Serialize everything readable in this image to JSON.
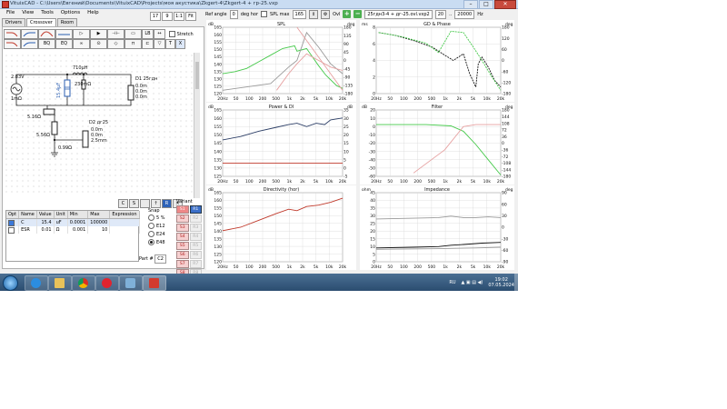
{
  "window": {
    "title": "VituixCAD - C:\\Users\\Евгений\\Documents\\VituixCAD\\Projects\\моя акустика\\Zkgert-4\\Zkgert-4 + гр-25.vxp",
    "min": "–",
    "max": "□",
    "close": "✕"
  },
  "menu": [
    "File",
    "View",
    "Tools",
    "Options",
    "Help"
  ],
  "topstrip": [
    "17",
    "9",
    "1:1",
    "Fit"
  ],
  "toolbar": {
    "ref_angle_label": "Ref angle",
    "ref_angle": "0",
    "ref_angle_unit": "deg hor",
    "spl_max_label": "SPL max",
    "spl_max": "165",
    "ovl_label": "Ovl",
    "ovl_file": "25гдн3-4 + дг-25.ovl.vxp2",
    "f_from": "20",
    "f_to": "20000",
    "f_unit": "Hz"
  },
  "tabs": [
    "Drivers",
    "Crossover",
    "Room"
  ],
  "palette": [
    {
      "label": "LP"
    },
    {
      "label": "HP"
    },
    {
      "label": "BP"
    },
    {
      "label": "AP"
    },
    {
      "label": "▷"
    },
    {
      "label": "▶"
    },
    {
      "label": "⊣⊢"
    },
    {
      "label": "▭"
    },
    {
      "label": "LP2"
    },
    {
      "label": "HP2"
    },
    {
      "label": "BQ"
    },
    {
      "label": "EQ"
    },
    {
      "label": "∞"
    },
    {
      "label": "⊙"
    },
    {
      "label": "◇"
    },
    {
      "label": "⊓"
    }
  ],
  "palette_right": [
    "LB",
    "↔",
    "⊏",
    "▽",
    "T",
    "X"
  ],
  "stretch_label": "Stretch",
  "schematic": {
    "source": "2.83V",
    "source_r": "1mΩ",
    "c1": "15.4μF",
    "l1": "710μH",
    "l1_r": "230mΩ",
    "r1": "5.16Ω",
    "r2": "5.56Ω",
    "r3": "0.99Ω",
    "d1_name": "D1 25гдн",
    "d1_params": [
      "0.0m",
      "0.0m",
      "0.0m"
    ],
    "d2_name": "D2 дг25",
    "d2_params": [
      "0.0m",
      "0.0m",
      "2.5mm"
    ]
  },
  "midstrip": [
    "C",
    "S",
    "",
    "↑",
    "R",
    "✕"
  ],
  "params": {
    "headers": [
      "Opt",
      "Name",
      "Value",
      "Unit",
      "Min",
      "Max",
      "Expression"
    ],
    "rows": [
      {
        "opt": true,
        "name": "C",
        "value": "15.4",
        "unit": "uF",
        "min": "0.0001",
        "max": "100000",
        "expr": ""
      },
      {
        "opt": false,
        "name": "ESR",
        "value": "0.01",
        "unit": "Ω",
        "min": "0.001",
        "max": "10",
        "expr": ""
      }
    ]
  },
  "snap": {
    "title": "Snap",
    "options": [
      "5 %",
      "E12",
      "E24",
      "E48"
    ],
    "selected": 3
  },
  "variant": {
    "title": "Variant",
    "rows": [
      [
        "S1",
        "R1"
      ],
      [
        "S2",
        "R2"
      ],
      [
        "S3",
        "R3"
      ],
      [
        "S4",
        "R4"
      ],
      [
        "S5",
        "R5"
      ],
      [
        "S6",
        "R6"
      ],
      [
        "S7",
        "R7"
      ],
      [
        "S8",
        "R8"
      ]
    ]
  },
  "part": {
    "label": "Part #",
    "value": "C2"
  },
  "charts": [
    {
      "title": "SPL",
      "unitL": "dB",
      "unitR": "deg",
      "yL": [
        "165",
        "160",
        "155",
        "150",
        "145",
        "140",
        "135",
        "130",
        "125",
        "120"
      ],
      "yR": [
        "180",
        "135",
        "90",
        "45",
        "0",
        "-45",
        "-90",
        "-135",
        "-180"
      ],
      "x": [
        "20Hz",
        "50",
        "100",
        "200",
        "500",
        "1k",
        "2k",
        "5k",
        "10k",
        "20k"
      ]
    },
    {
      "title": "GD & Phase",
      "unitL": "ms",
      "unitR": "deg",
      "yL": [
        "8",
        "6",
        "4",
        "2",
        "0"
      ],
      "yR": [
        "180",
        "120",
        "60",
        "0",
        "-60",
        "-120",
        "-180"
      ],
      "x": [
        "20Hz",
        "50",
        "100",
        "200",
        "500",
        "1k",
        "2k",
        "5k",
        "10k",
        "20k"
      ]
    },
    {
      "title": "Power & DI",
      "unitL": "dB",
      "unitR": "dB",
      "yL": [
        "165",
        "160",
        "155",
        "150",
        "145",
        "140",
        "135",
        "130",
        "125"
      ],
      "yR": [
        "35",
        "30",
        "25",
        "20",
        "15",
        "10",
        "5",
        "0",
        "-5"
      ],
      "x": [
        "20Hz",
        "50",
        "100",
        "200",
        "500",
        "1k",
        "2k",
        "5k",
        "10k",
        "20k"
      ]
    },
    {
      "title": "Filter",
      "unitL": "dB",
      "unitR": "deg",
      "yL": [
        "20",
        "10",
        "0",
        "-10",
        "-20",
        "-30",
        "-40",
        "-50",
        "-60"
      ],
      "yR": [
        "180",
        "144",
        "108",
        "72",
        "36",
        "0",
        "-36",
        "-72",
        "-108",
        "-144",
        "-180"
      ],
      "x": [
        "20Hz",
        "50",
        "100",
        "200",
        "500",
        "1k",
        "2k",
        "5k",
        "10k",
        "20k"
      ]
    },
    {
      "title": "Directivity (hor)",
      "unitL": "dB",
      "unitR": "",
      "yL": [
        "165",
        "160",
        "155",
        "150",
        "145",
        "140",
        "135",
        "130",
        "125",
        "120"
      ],
      "yR": [],
      "x": [
        "20Hz",
        "50",
        "100",
        "200",
        "500",
        "1k",
        "2k",
        "5k",
        "10k",
        "20k"
      ]
    },
    {
      "title": "Impedance",
      "unitL": "ohm",
      "unitR": "deg",
      "yL": [
        "45",
        "40",
        "35",
        "30",
        "25",
        "20",
        "15",
        "10",
        "5",
        "0"
      ],
      "yR": [
        "90",
        "60",
        "30",
        "0",
        "-30",
        "-60",
        "-90"
      ],
      "x": [
        "20Hz",
        "50",
        "100",
        "200",
        "500",
        "1k",
        "2k",
        "5k",
        "10k",
        "20k"
      ]
    }
  ],
  "colors": {
    "green": "#45c94a",
    "red": "#c0392b",
    "navy": "#2c3e66",
    "pink": "#e6a0a0",
    "black": "#111111",
    "grey": "#9a9a9a"
  },
  "tray": {
    "lang": "RU",
    "time": "19:02",
    "date": "07.05.2024"
  }
}
